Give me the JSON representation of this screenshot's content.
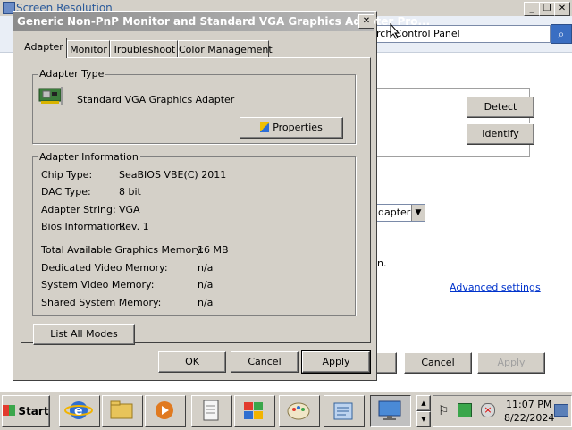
{
  "background": {
    "title": "Screen Resolution",
    "address_text": "rch Control Panel",
    "detect_label": "Detect",
    "identify_label": "Identify",
    "dropdown_value": "dapter",
    "partial_text": "n.",
    "advanced_link": "Advanced settings",
    "cancel_label": "Cancel",
    "apply_label": "Apply"
  },
  "dialog": {
    "title": "Generic Non-PnP Monitor and Standard VGA Graphics Adapter Pro...",
    "tabs": [
      "Adapter",
      "Monitor",
      "Troubleshoot",
      "Color Management"
    ],
    "adapter_type": {
      "legend": "Adapter Type",
      "name": "Standard VGA Graphics Adapter",
      "properties_label": "Properties"
    },
    "adapter_info": {
      "legend": "Adapter Information",
      "rows": [
        {
          "label": "Chip Type:",
          "value": "SeaBIOS VBE(C) 2011"
        },
        {
          "label": "DAC Type:",
          "value": "8 bit"
        },
        {
          "label": "Adapter String:",
          "value": "VGA"
        },
        {
          "label": "Bios Information:",
          "value": "Rev. 1"
        }
      ],
      "memory": [
        {
          "label": "Total Available Graphics Memory:",
          "value": "16 MB"
        },
        {
          "label": "Dedicated Video Memory:",
          "value": "n/a"
        },
        {
          "label": "System Video Memory:",
          "value": "n/a"
        },
        {
          "label": "Shared System Memory:",
          "value": "n/a"
        }
      ]
    },
    "list_modes_label": "List All Modes",
    "ok_label": "OK",
    "cancel_label": "Cancel",
    "apply_label": "Apply"
  },
  "taskbar": {
    "start_label": "Start",
    "time": "11:07 PM",
    "date": "8/22/2024"
  }
}
